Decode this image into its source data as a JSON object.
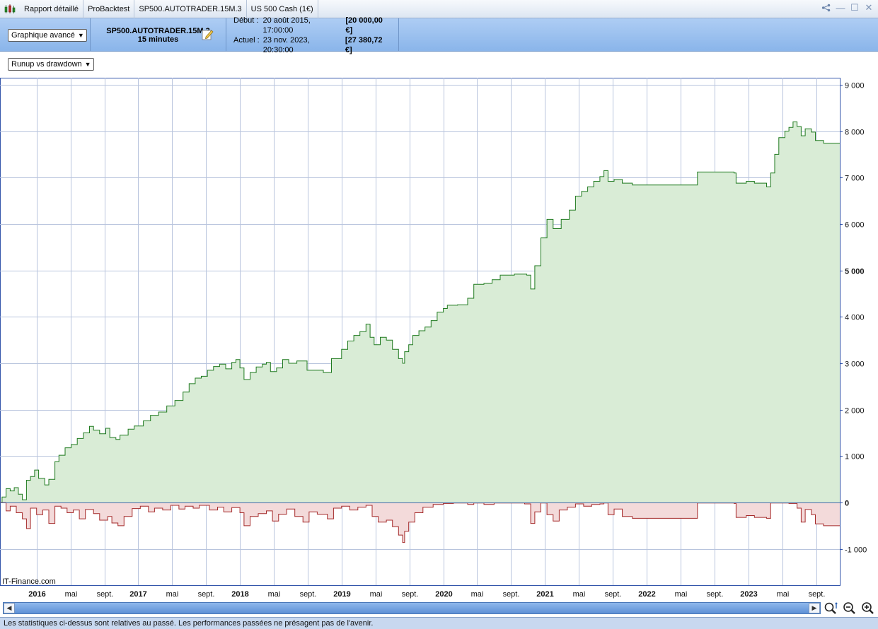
{
  "tabs": [
    {
      "label": "Rapport détaillé"
    },
    {
      "label": "ProBacktest"
    },
    {
      "label": "SP500.AUTOTRADER.15M.3"
    },
    {
      "label": "US 500 Cash (1€)"
    }
  ],
  "header": {
    "view_select": "Graphique avancé",
    "instrument_name": "SP500.AUTOTRADER.15M.3",
    "timeframe": "15 minutes",
    "start_label": "Début :",
    "start_date": "20 août 2015, 17:00:00",
    "start_capital": "[20 000,00 €]",
    "current_label": "Actuel :",
    "current_date": "23 nov. 2023, 20:30:00",
    "current_capital": "[27 380,72 €]"
  },
  "chart_select": "Runup vs drawdown",
  "watermark": "IT-Finance.com",
  "footer_text": "Les statistiques ci-dessus sont relatives au passé. Les performances passées ne présagent pas de l'avenir.",
  "colors": {
    "runup_line": "#1f7a1f",
    "runup_fill": "#d9ecd6",
    "drawdown_line": "#a52a2a",
    "drawdown_fill": "#f3dada",
    "grid": "#b8c4dd",
    "axis": "#3355aa"
  },
  "chart_data": {
    "type": "area",
    "x_axis_labels": [
      {
        "t": 2016.0,
        "label": "2016",
        "bold": true
      },
      {
        "t": 2016.333,
        "label": "mai",
        "bold": false
      },
      {
        "t": 2016.667,
        "label": "sept.",
        "bold": false
      },
      {
        "t": 2017.0,
        "label": "2017",
        "bold": true
      },
      {
        "t": 2017.333,
        "label": "mai",
        "bold": false
      },
      {
        "t": 2017.667,
        "label": "sept.",
        "bold": false
      },
      {
        "t": 2018.0,
        "label": "2018",
        "bold": true
      },
      {
        "t": 2018.333,
        "label": "mai",
        "bold": false
      },
      {
        "t": 2018.667,
        "label": "sept.",
        "bold": false
      },
      {
        "t": 2019.0,
        "label": "2019",
        "bold": true
      },
      {
        "t": 2019.333,
        "label": "mai",
        "bold": false
      },
      {
        "t": 2019.667,
        "label": "sept.",
        "bold": false
      },
      {
        "t": 2020.0,
        "label": "2020",
        "bold": true
      },
      {
        "t": 2020.333,
        "label": "mai",
        "bold": false
      },
      {
        "t": 2020.667,
        "label": "sept.",
        "bold": false
      },
      {
        "t": 2021.0,
        "label": "2021",
        "bold": true
      },
      {
        "t": 2021.333,
        "label": "mai",
        "bold": false
      },
      {
        "t": 2021.667,
        "label": "sept.",
        "bold": false
      },
      {
        "t": 2022.0,
        "label": "2022",
        "bold": true
      },
      {
        "t": 2022.333,
        "label": "mai",
        "bold": false
      },
      {
        "t": 2022.667,
        "label": "sept.",
        "bold": false
      },
      {
        "t": 2023.0,
        "label": "2023",
        "bold": true
      },
      {
        "t": 2023.333,
        "label": "mai",
        "bold": false
      },
      {
        "t": 2023.667,
        "label": "sept.",
        "bold": false
      }
    ],
    "y_ticks": [
      {
        "v": 9000,
        "label": "9 000",
        "bold": false
      },
      {
        "v": 8000,
        "label": "8 000",
        "bold": false
      },
      {
        "v": 7000,
        "label": "7 000",
        "bold": false
      },
      {
        "v": 6000,
        "label": "6 000",
        "bold": false
      },
      {
        "v": 5000,
        "label": "5 000",
        "bold": true
      },
      {
        "v": 4000,
        "label": "4 000",
        "bold": false
      },
      {
        "v": 3000,
        "label": "3 000",
        "bold": false
      },
      {
        "v": 2000,
        "label": "2 000",
        "bold": false
      },
      {
        "v": 1000,
        "label": "1 000",
        "bold": false
      },
      {
        "v": 0,
        "label": "0",
        "bold": true
      },
      {
        "v": -1000,
        "label": "-1 000",
        "bold": false
      }
    ],
    "ylim": [
      -1780,
      9150
    ],
    "xlim": [
      2015.64,
      2023.9
    ],
    "series": [
      {
        "name": "runup",
        "points": [
          [
            2015.64,
            0
          ],
          [
            2015.66,
            120
          ],
          [
            2015.7,
            300
          ],
          [
            2015.74,
            250
          ],
          [
            2015.78,
            320
          ],
          [
            2015.82,
            180
          ],
          [
            2015.86,
            60
          ],
          [
            2015.9,
            480
          ],
          [
            2015.94,
            560
          ],
          [
            2015.98,
            700
          ],
          [
            2016.02,
            520
          ],
          [
            2016.08,
            380
          ],
          [
            2016.12,
            500
          ],
          [
            2016.18,
            880
          ],
          [
            2016.22,
            1020
          ],
          [
            2016.28,
            1180
          ],
          [
            2016.34,
            1250
          ],
          [
            2016.4,
            1380
          ],
          [
            2016.46,
            1500
          ],
          [
            2016.52,
            1640
          ],
          [
            2016.56,
            1560
          ],
          [
            2016.62,
            1480
          ],
          [
            2016.68,
            1600
          ],
          [
            2016.72,
            1400
          ],
          [
            2016.78,
            1360
          ],
          [
            2016.82,
            1450
          ],
          [
            2016.9,
            1580
          ],
          [
            2016.96,
            1650
          ],
          [
            2017.05,
            1760
          ],
          [
            2017.12,
            1880
          ],
          [
            2017.2,
            1950
          ],
          [
            2017.28,
            2080
          ],
          [
            2017.36,
            2200
          ],
          [
            2017.44,
            2380
          ],
          [
            2017.5,
            2560
          ],
          [
            2017.56,
            2680
          ],
          [
            2017.62,
            2720
          ],
          [
            2017.68,
            2850
          ],
          [
            2017.74,
            2930
          ],
          [
            2017.8,
            2980
          ],
          [
            2017.86,
            2880
          ],
          [
            2017.92,
            3020
          ],
          [
            2017.96,
            3080
          ],
          [
            2018.0,
            2900
          ],
          [
            2018.04,
            2650
          ],
          [
            2018.1,
            2800
          ],
          [
            2018.16,
            2920
          ],
          [
            2018.22,
            2980
          ],
          [
            2018.26,
            3020
          ],
          [
            2018.3,
            2820
          ],
          [
            2018.36,
            2900
          ],
          [
            2018.42,
            3080
          ],
          [
            2018.48,
            3000
          ],
          [
            2018.56,
            3050
          ],
          [
            2018.66,
            2850
          ],
          [
            2018.82,
            2800
          ],
          [
            2018.9,
            3100
          ],
          [
            2019.0,
            3300
          ],
          [
            2019.06,
            3480
          ],
          [
            2019.12,
            3600
          ],
          [
            2019.18,
            3680
          ],
          [
            2019.24,
            3840
          ],
          [
            2019.28,
            3560
          ],
          [
            2019.32,
            3400
          ],
          [
            2019.38,
            3560
          ],
          [
            2019.44,
            3500
          ],
          [
            2019.5,
            3300
          ],
          [
            2019.56,
            3100
          ],
          [
            2019.6,
            3000
          ],
          [
            2019.62,
            3250
          ],
          [
            2019.66,
            3400
          ],
          [
            2019.7,
            3600
          ],
          [
            2019.76,
            3700
          ],
          [
            2019.82,
            3780
          ],
          [
            2019.88,
            3920
          ],
          [
            2019.94,
            4100
          ],
          [
            2020.0,
            4180
          ],
          [
            2020.04,
            4250
          ],
          [
            2020.14,
            4260
          ],
          [
            2020.24,
            4400
          ],
          [
            2020.3,
            4700
          ],
          [
            2020.4,
            4720
          ],
          [
            2020.48,
            4800
          ],
          [
            2020.56,
            4900
          ],
          [
            2020.7,
            4920
          ],
          [
            2020.82,
            4900
          ],
          [
            2020.86,
            4600
          ],
          [
            2020.9,
            5100
          ],
          [
            2020.96,
            5700
          ],
          [
            2021.02,
            6100
          ],
          [
            2021.08,
            5900
          ],
          [
            2021.16,
            6100
          ],
          [
            2021.24,
            6300
          ],
          [
            2021.3,
            6600
          ],
          [
            2021.36,
            6700
          ],
          [
            2021.42,
            6800
          ],
          [
            2021.48,
            6920
          ],
          [
            2021.54,
            7020
          ],
          [
            2021.58,
            7150
          ],
          [
            2021.62,
            6920
          ],
          [
            2021.68,
            6960
          ],
          [
            2021.76,
            6880
          ],
          [
            2021.86,
            6840
          ],
          [
            2022.0,
            6840
          ],
          [
            2022.16,
            6840
          ],
          [
            2022.36,
            6840
          ],
          [
            2022.48,
            6840
          ],
          [
            2022.5,
            7120
          ],
          [
            2022.7,
            7120
          ],
          [
            2022.86,
            7100
          ],
          [
            2022.88,
            6880
          ],
          [
            2022.98,
            6920
          ],
          [
            2023.06,
            6880
          ],
          [
            2023.18,
            6800
          ],
          [
            2023.22,
            7100
          ],
          [
            2023.26,
            7500
          ],
          [
            2023.3,
            7860
          ],
          [
            2023.36,
            8000
          ],
          [
            2023.4,
            8080
          ],
          [
            2023.44,
            8200
          ],
          [
            2023.48,
            8100
          ],
          [
            2023.52,
            7900
          ],
          [
            2023.56,
            8050
          ],
          [
            2023.62,
            7980
          ],
          [
            2023.66,
            7800
          ],
          [
            2023.74,
            7740
          ],
          [
            2023.82,
            7740
          ],
          [
            2023.9,
            7740
          ]
        ]
      },
      {
        "name": "drawdown",
        "points": [
          [
            2015.64,
            0
          ],
          [
            2015.7,
            -180
          ],
          [
            2015.74,
            -80
          ],
          [
            2015.8,
            -220
          ],
          [
            2015.86,
            -350
          ],
          [
            2015.9,
            -560
          ],
          [
            2015.94,
            -120
          ],
          [
            2016.0,
            -260
          ],
          [
            2016.06,
            -160
          ],
          [
            2016.12,
            -450
          ],
          [
            2016.18,
            -80
          ],
          [
            2016.24,
            -120
          ],
          [
            2016.3,
            -220
          ],
          [
            2016.36,
            -160
          ],
          [
            2016.42,
            -350
          ],
          [
            2016.48,
            -150
          ],
          [
            2016.56,
            -240
          ],
          [
            2016.62,
            -380
          ],
          [
            2016.7,
            -300
          ],
          [
            2016.74,
            -440
          ],
          [
            2016.8,
            -500
          ],
          [
            2016.86,
            -300
          ],
          [
            2016.94,
            -130
          ],
          [
            2017.02,
            -80
          ],
          [
            2017.1,
            -200
          ],
          [
            2017.16,
            -120
          ],
          [
            2017.24,
            -160
          ],
          [
            2017.32,
            -60
          ],
          [
            2017.4,
            -140
          ],
          [
            2017.46,
            -80
          ],
          [
            2017.54,
            -120
          ],
          [
            2017.6,
            -60
          ],
          [
            2017.7,
            -160
          ],
          [
            2017.78,
            -100
          ],
          [
            2017.84,
            -200
          ],
          [
            2017.92,
            -110
          ],
          [
            2018.0,
            -220
          ],
          [
            2018.04,
            -500
          ],
          [
            2018.1,
            -300
          ],
          [
            2018.18,
            -240
          ],
          [
            2018.26,
            -180
          ],
          [
            2018.32,
            -400
          ],
          [
            2018.38,
            -250
          ],
          [
            2018.46,
            -140
          ],
          [
            2018.54,
            -300
          ],
          [
            2018.62,
            -420
          ],
          [
            2018.68,
            -200
          ],
          [
            2018.76,
            -250
          ],
          [
            2018.86,
            -350
          ],
          [
            2018.92,
            -120
          ],
          [
            2019.0,
            -80
          ],
          [
            2019.08,
            -160
          ],
          [
            2019.16,
            -100
          ],
          [
            2019.24,
            -60
          ],
          [
            2019.3,
            -300
          ],
          [
            2019.36,
            -420
          ],
          [
            2019.44,
            -380
          ],
          [
            2019.5,
            -520
          ],
          [
            2019.56,
            -700
          ],
          [
            2019.6,
            -860
          ],
          [
            2019.62,
            -620
          ],
          [
            2019.66,
            -420
          ],
          [
            2019.72,
            -220
          ],
          [
            2019.8,
            -100
          ],
          [
            2019.9,
            -40
          ],
          [
            2020.0,
            -20
          ],
          [
            2020.1,
            -10
          ],
          [
            2020.24,
            -40
          ],
          [
            2020.3,
            -10
          ],
          [
            2020.4,
            -40
          ],
          [
            2020.5,
            -10
          ],
          [
            2020.7,
            -10
          ],
          [
            2020.8,
            -30
          ],
          [
            2020.86,
            -450
          ],
          [
            2020.9,
            -200
          ],
          [
            2020.96,
            -10
          ],
          [
            2021.02,
            -260
          ],
          [
            2021.08,
            -400
          ],
          [
            2021.14,
            -160
          ],
          [
            2021.22,
            -100
          ],
          [
            2021.3,
            -30
          ],
          [
            2021.38,
            -80
          ],
          [
            2021.46,
            -40
          ],
          [
            2021.54,
            -30
          ],
          [
            2021.58,
            -10
          ],
          [
            2021.62,
            -260
          ],
          [
            2021.68,
            -140
          ],
          [
            2021.76,
            -300
          ],
          [
            2021.86,
            -340
          ],
          [
            2022.0,
            -340
          ],
          [
            2022.3,
            -340
          ],
          [
            2022.48,
            -340
          ],
          [
            2022.5,
            -10
          ],
          [
            2022.7,
            -10
          ],
          [
            2022.86,
            -20
          ],
          [
            2022.88,
            -320
          ],
          [
            2022.98,
            -280
          ],
          [
            2023.06,
            -320
          ],
          [
            2023.18,
            -340
          ],
          [
            2023.22,
            -10
          ],
          [
            2023.4,
            -20
          ],
          [
            2023.48,
            -120
          ],
          [
            2023.52,
            -420
          ],
          [
            2023.56,
            -150
          ],
          [
            2023.62,
            -260
          ],
          [
            2023.66,
            -460
          ],
          [
            2023.74,
            -500
          ],
          [
            2023.82,
            -500
          ],
          [
            2023.9,
            -500
          ]
        ]
      }
    ]
  }
}
